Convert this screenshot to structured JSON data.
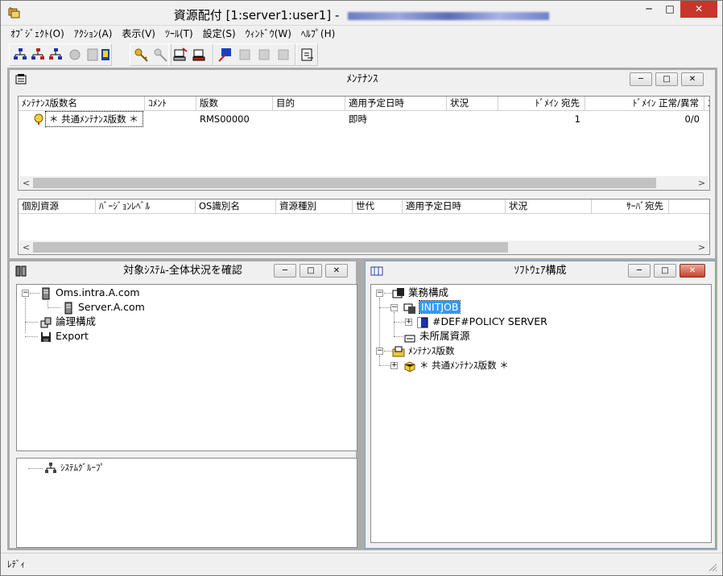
{
  "window": {
    "title": "資源配付 [1:server1:user1]",
    "title_sep": "-",
    "min_label": "─",
    "max_label": "□",
    "close_label": "✕"
  },
  "menu": [
    "ｵﾌﾞｼﾞｪｸﾄ(O)",
    "ｱｸｼｮﾝ(A)",
    "表示(V)",
    "ﾂｰﾙ(T)",
    "設定(S)",
    "ｳｨﾝﾄﾞｳ(W)",
    "ﾍﾙﾌﾟ(H)"
  ],
  "maintenance": {
    "title": "ﾒﾝﾃﾅﾝｽ",
    "columns": [
      "ﾒﾝﾃﾅﾝｽ版数名",
      "ｺﾒﾝﾄ",
      "版数",
      "目的",
      "適用予定日時",
      "状況",
      "ﾄﾞﾒｲﾝ 宛先",
      "ﾄﾞﾒｲﾝ 正常/異常",
      "ｴ"
    ],
    "rows": [
      {
        "name": "＊ 共通ﾒﾝﾃﾅﾝｽ版数 ＊",
        "comment": "",
        "version": "RMS00000",
        "purpose": "",
        "schedule": "即時",
        "status": "",
        "dest": "1",
        "normal": "0/0"
      }
    ],
    "lower_columns": [
      "個別資源",
      "ﾊﾞｰｼﾞｮﾝﾚﾍﾞﾙ",
      "OS識別名",
      "資源種別",
      "世代",
      "適用予定日時",
      "状況",
      "ｻｰﾊﾞ宛先"
    ]
  },
  "system_status": {
    "title": "対象ｼｽﾃﾑ-全体状況を確認",
    "tree": [
      "Oms.intra.A.com",
      "Server.A.com",
      "論理構成",
      "Export"
    ],
    "lower_tree": [
      "ｼｽﾃﾑｸﾞﾙｰﾌﾟ"
    ]
  },
  "software": {
    "title": "ｿﾌﾄｳｪｱ構成",
    "tree": [
      "業務構成",
      "INITJOB",
      "#DEF#POLICY SERVER",
      "未所属資源",
      "ﾒﾝﾃﾅﾝｽ版数",
      "＊ 共通ﾒﾝﾃﾅﾝｽ版数 ＊"
    ]
  },
  "scroll": {
    "left": "<",
    "right": ">"
  },
  "status": "ﾚﾃﾞｨ",
  "colors": {
    "selection": "#3399ff",
    "close_red": "#c8402a",
    "mdi_bg": "#ababab"
  }
}
